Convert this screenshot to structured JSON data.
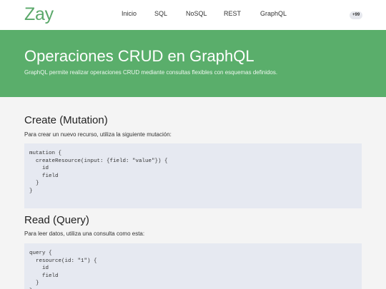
{
  "brand": "Zay",
  "nav": {
    "items": [
      "Inicio",
      "SQL",
      "NoSQL",
      "REST",
      "GraphQL"
    ],
    "badge": "+99"
  },
  "hero": {
    "title": "Operaciones CRUD en GraphQL",
    "subtitle": "GraphQL permite realizar operaciones CRUD mediante consultas flexibles con esquemas definidos."
  },
  "sections": [
    {
      "title": "Create (Mutation)",
      "description": "Para crear un nuevo recurso, utiliza la siguiente mutación:",
      "code": "mutation {\n  createResource(input: {field: \"value\"}) {\n    id\n    field\n  }\n}"
    },
    {
      "title": "Read (Query)",
      "description": "Para leer datos, utiliza una consulta como esta:",
      "code": "query {\n  resource(id: \"1\") {\n    id\n    field\n  }\n}"
    }
  ],
  "colors": {
    "brand": "#5aa86a",
    "hero_bg": "#5aae6b",
    "code_bg": "#e6e9f1"
  }
}
